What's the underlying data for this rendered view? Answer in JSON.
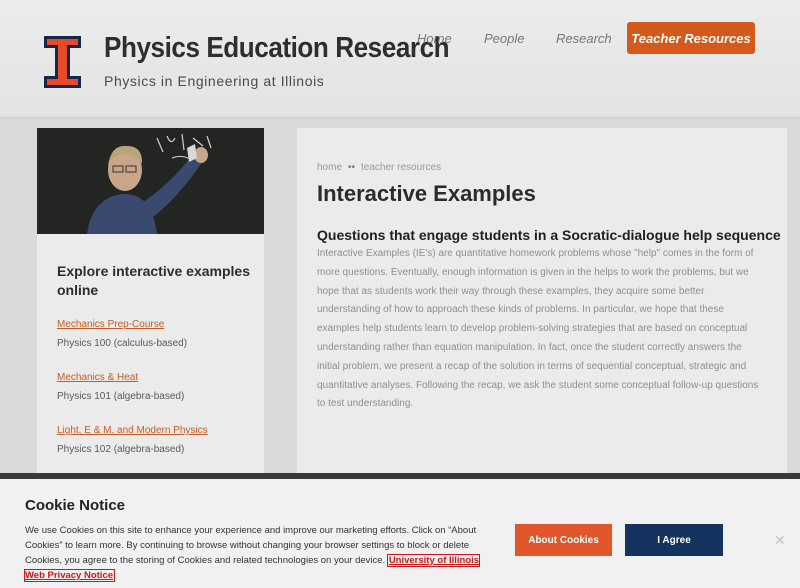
{
  "header": {
    "title": "Physics Education Research",
    "subtitle": "Physics in Engineering at Illinois",
    "nav": {
      "home": "Home",
      "people": "People",
      "research": "Research",
      "teacher_resources": "Teacher Resources"
    }
  },
  "sidebar": {
    "heading": "Explore interactive examples online",
    "courses": [
      {
        "link": "Mechanics Prep-Course",
        "desc": "Physics 100 (calculus-based)"
      },
      {
        "link": "Mechanics & Heat",
        "desc": "Physics 101 (algebra-based)"
      },
      {
        "link": "Light, E & M, and Modern Physics",
        "desc": "Physics 102 (algebra-based)"
      }
    ]
  },
  "main": {
    "breadcrumb": {
      "home": "home",
      "separator": "••",
      "current": "teacher resources"
    },
    "title": "Interactive Examples",
    "subheading": "Questions that engage students in a Socratic-dialogue help sequence",
    "body": "Interactive Examples (IE's) are quantitative homework problems whose \"help\" comes in the form of more questions. Eventually, enough information is given in the helps to work the problems, but we hope that as students work their way through these examples, they acquire some better understanding of how to approach these kinds of problems. In particular, we hope that these examples help students learn to develop problem-solving strategies that are based on conceptual understanding rather than equation manipulation. In fact, once the student correctly answers the initial problem, we present a recap of the solution in terms of sequential conceptual, strategic and quantitative analyses. Following the recap, we ask the student some conceptual follow-up questions to test understanding."
  },
  "cookie": {
    "title": "Cookie Notice",
    "text": "We use Cookies on this site to enhance your experience and improve our marketing efforts. Click on “About Cookies” to learn more. By continuing to browse without changing your browser settings to block or delete Cookies, you agree to the storing of Cookies and related technologies on your device. ",
    "link": "University of Illinois Web Privacy Notice",
    "about_button": "About Cookies",
    "agree_button": "I Agree",
    "close": "✕"
  },
  "colors": {
    "accent_orange": "#d35a1c",
    "illinois_orange": "#e84a27",
    "illinois_blue": "#13294b",
    "agree_button": "#14345f"
  },
  "icons": {
    "logo": "block-i-logo",
    "close": "close-icon"
  }
}
